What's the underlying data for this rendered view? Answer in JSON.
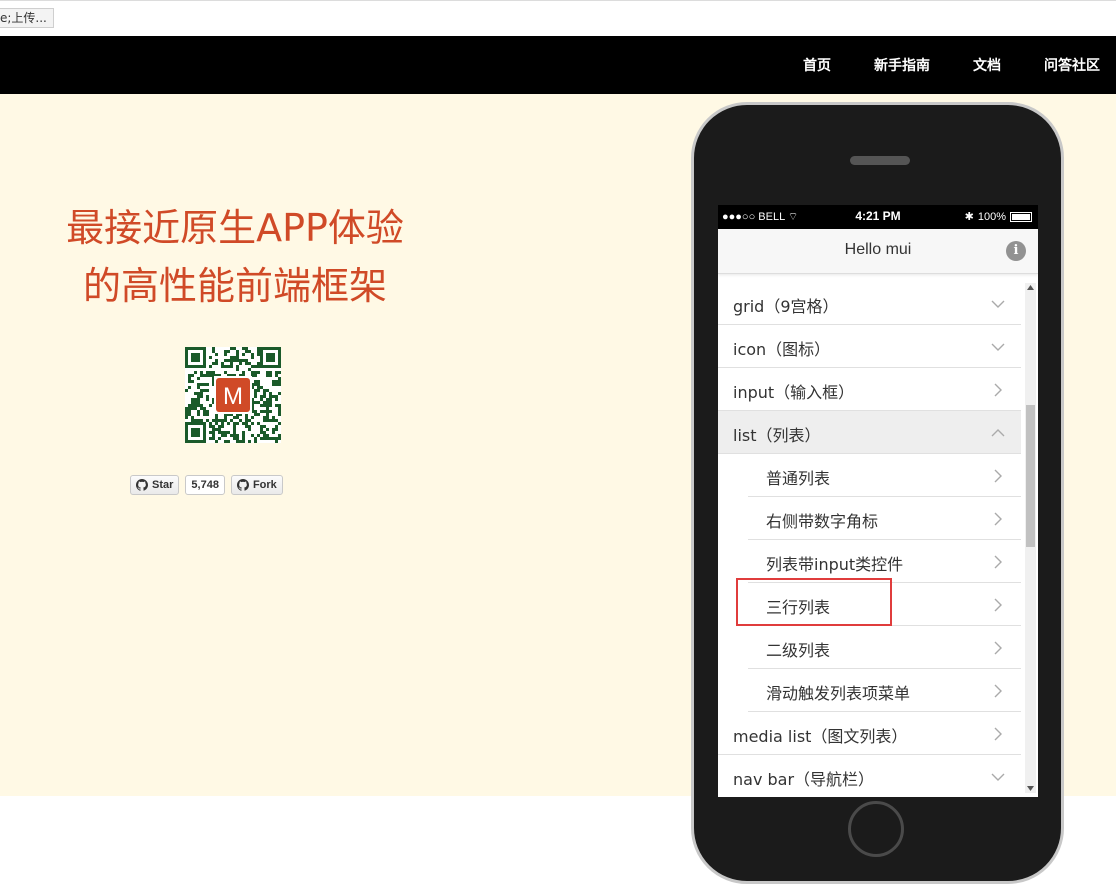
{
  "browser": {
    "status_text": "e;上传..."
  },
  "nav": {
    "links": [
      "首页",
      "新手指南",
      "文档",
      "问答社区"
    ]
  },
  "hero": {
    "headline_line1": "最接近原生APP体验",
    "headline_line2": "的高性能前端框架",
    "qr_logo": "M",
    "github": {
      "star_label": "Star",
      "star_count": "5,748",
      "fork_label": "Fork"
    }
  },
  "phone": {
    "status": {
      "carrier": "●●●○○ BELL",
      "time": "4:21 PM",
      "battery": "100%"
    },
    "header_title": "Hello mui",
    "info_icon": "i",
    "list": [
      {
        "label": "grid（9宫格）",
        "icon": "chevron-down-icon"
      },
      {
        "label": "icon（图标）",
        "icon": "chevron-down-icon"
      },
      {
        "label": "input（输入框）",
        "icon": "chevron-right-icon"
      },
      {
        "label": "list（列表）",
        "icon": "chevron-up-icon"
      },
      {
        "label": "普通列表",
        "icon": "chevron-right-icon"
      },
      {
        "label": "右侧带数字角标",
        "icon": "chevron-right-icon"
      },
      {
        "label": "列表带input类控件",
        "icon": "chevron-right-icon"
      },
      {
        "label": "三行列表",
        "icon": "chevron-right-icon"
      },
      {
        "label": "二级列表",
        "icon": "chevron-right-icon"
      },
      {
        "label": "滑动触发列表项菜单",
        "icon": "chevron-right-icon"
      },
      {
        "label": "media list（图文列表）",
        "icon": "chevron-right-icon"
      },
      {
        "label": "nav bar（导航栏）",
        "icon": "chevron-down-icon"
      }
    ]
  },
  "colors": {
    "accent": "#d04a27",
    "hero_bg": "#fff9e5",
    "highlight": "#e03c3c"
  }
}
